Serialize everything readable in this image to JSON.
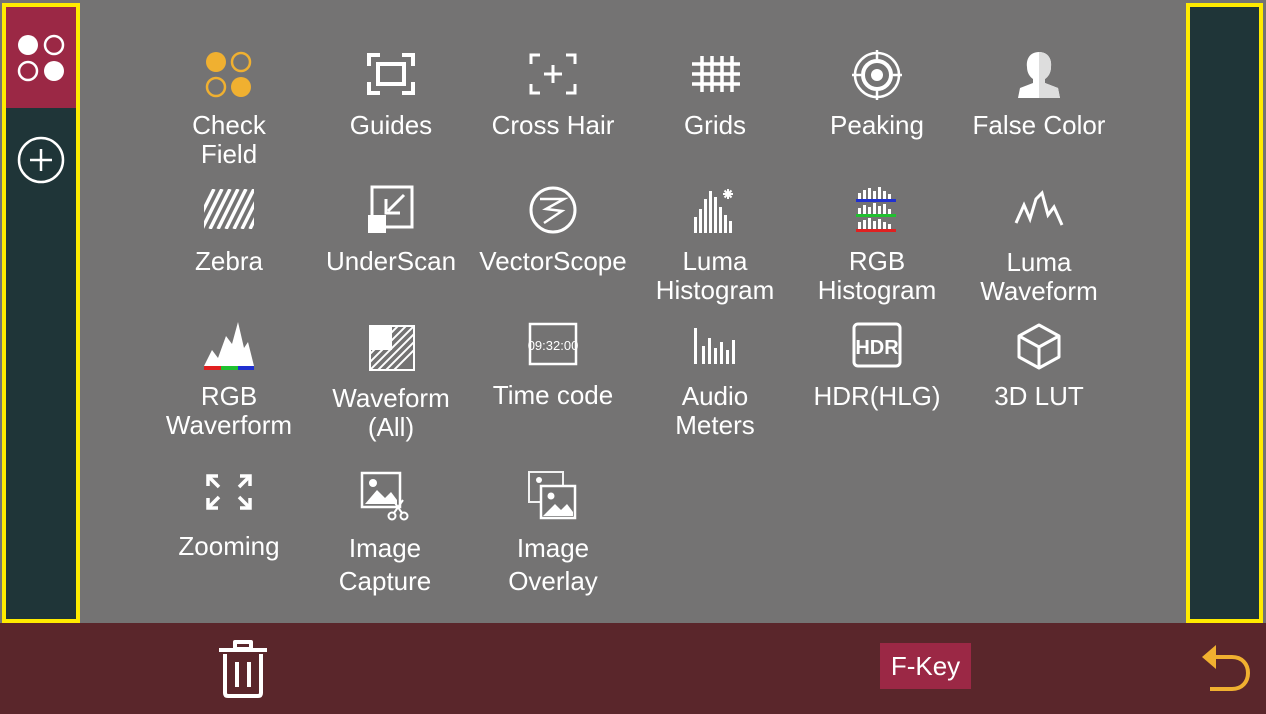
{
  "sidebar": {
    "tabs": [
      {
        "name": "functions-grid-icon",
        "active": true
      },
      {
        "name": "add-circle-icon",
        "active": false
      }
    ]
  },
  "functions": [
    {
      "label": "Check\nField",
      "icon": "check-field-icon"
    },
    {
      "label": "Guides",
      "icon": "guides-icon"
    },
    {
      "label": "Cross Hair",
      "icon": "cross-hair-icon"
    },
    {
      "label": "Grids",
      "icon": "grids-icon"
    },
    {
      "label": "Peaking",
      "icon": "peaking-icon"
    },
    {
      "label": "False Color",
      "icon": "false-color-icon"
    },
    {
      "label": "Zebra",
      "icon": "zebra-icon"
    },
    {
      "label": "UnderScan",
      "icon": "underscan-icon"
    },
    {
      "label": "VectorScope",
      "icon": "vectorscope-icon"
    },
    {
      "label": "Luma\nHistogram",
      "icon": "luma-histogram-icon"
    },
    {
      "label": "RGB\nHistogram",
      "icon": "rgb-histogram-icon"
    },
    {
      "label": "Luma\nWaveform",
      "icon": "luma-waveform-icon"
    },
    {
      "label": "RGB\nWaverform",
      "icon": "rgb-waveform-icon"
    },
    {
      "label": "Waveform\n(All)",
      "icon": "waveform-all-icon"
    },
    {
      "label": "Time code",
      "icon": "time-code-icon",
      "icon_text": "09:32:00"
    },
    {
      "label": "Audio\nMeters",
      "icon": "audio-meters-icon"
    },
    {
      "label": "HDR(HLG)",
      "icon": "hdr-icon",
      "icon_text": "HDR"
    },
    {
      "label": "3D LUT",
      "icon": "cube-icon"
    },
    {
      "label": "Zooming",
      "icon": "zoom-icon"
    },
    {
      "label": "Image\nCapture",
      "icon": "image-capture-icon"
    },
    {
      "label": "Image\nOverlay",
      "icon": "image-overlay-icon"
    }
  ],
  "bottom": {
    "fkey_label": "F-Key",
    "trash_icon": "trash-icon",
    "back_icon": "back-arrow-icon"
  },
  "colors": {
    "accent": "#9b2845",
    "highlight": "#ffeb00",
    "panel": "#1f3538",
    "main_bg": "#747373",
    "bottom_bar": "#5a262b",
    "icon_orange": "#f0b030"
  }
}
